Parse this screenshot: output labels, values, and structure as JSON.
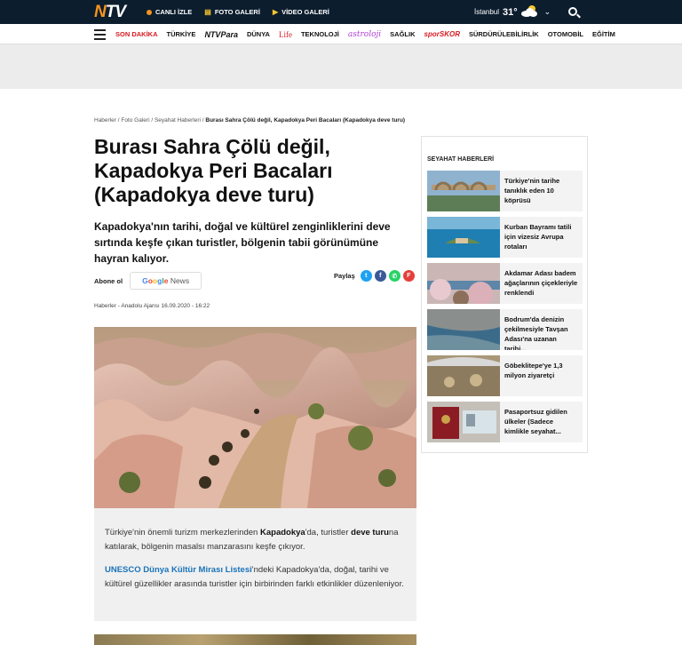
{
  "topbar": {
    "logo": "NTV",
    "links": [
      {
        "label": "CANLI İZLE",
        "icon": "live-dot-icon"
      },
      {
        "label": "FOTO GALERİ",
        "icon": "gallery-icon"
      },
      {
        "label": "VİDEO GALERİ",
        "icon": "play-icon"
      }
    ],
    "weather": {
      "city": "İstanbul",
      "temp": "31°",
      "icon": "partly-cloudy-icon"
    }
  },
  "nav": {
    "items": [
      "SON DAKİKA",
      "TÜRKİYE",
      "NTVPara",
      "DÜNYA",
      "Life",
      "TEKNOLOJİ",
      "astroloji",
      "SAĞLIK",
      "sporSKOR",
      "SÜRDÜRÜLEBİLİRLİK",
      "OTOMOBİL",
      "EĞİTİM"
    ]
  },
  "breadcrumb": {
    "items": [
      "Haberler",
      "Foto Galeri",
      "Seyahat Haberleri"
    ],
    "current": "Burası Sahra Çölü değil, Kapadokya Peri Bacaları (Kapadokya deve turu)"
  },
  "article": {
    "title": "Burası Sahra Çölü değil, Kapadokya Peri Bacaları (Kapadokya deve turu)",
    "lead": "Kapadokya'nın tarihi, doğal ve kültürel zenginliklerini deve sırtında keşfe çıkan turistler, bölgenin tabii görünümüne hayran kalıyor.",
    "abone_label": "Abone ol",
    "gnews_google": "Google",
    "gnews_news": "News",
    "share_label": "Paylaş",
    "meta": "Haberler - Anadolu Ajansı 16.09.2020 - 16:22",
    "p1_a": "Türkiye'nin önemli turizm merkezlerinden ",
    "p1_b": "Kapadokya",
    "p1_c": "'da, turistler ",
    "p1_d": "deve turu",
    "p1_e": "na katılarak, bölgenin masalsı manzarasını keşfe çıkıyor.",
    "p2_link": "UNESCO Dünya Kültür Mirası Listesi",
    "p2_rest": "'ndeki Kapadokya'da, doğal, tarihi ve kültürel güzellikler arasında turistler için birbirinden farklı etkinlikler düzenleniyor."
  },
  "sidebar": {
    "title": "SEYAHAT HABERLERİ",
    "items": [
      {
        "label": "Türkiye'nin tarihe tanıklık eden 10 köprüsü"
      },
      {
        "label": "Kurban Bayramı tatili için vizesiz Avrupa rotaları"
      },
      {
        "label": "Akdamar Adası badem ağaçlarının çiçekleriyle renklendi"
      },
      {
        "label": "Bodrum'da denizin çekilmesiyle Tavşan Adası'na uzanan tarihi..."
      },
      {
        "label": "Göbeklitepe'ye 1,3 milyon ziyaretçi"
      },
      {
        "label": "Pasaportsuz gidilen ülkeler (Sadece kimlikle seyahat..."
      }
    ]
  }
}
